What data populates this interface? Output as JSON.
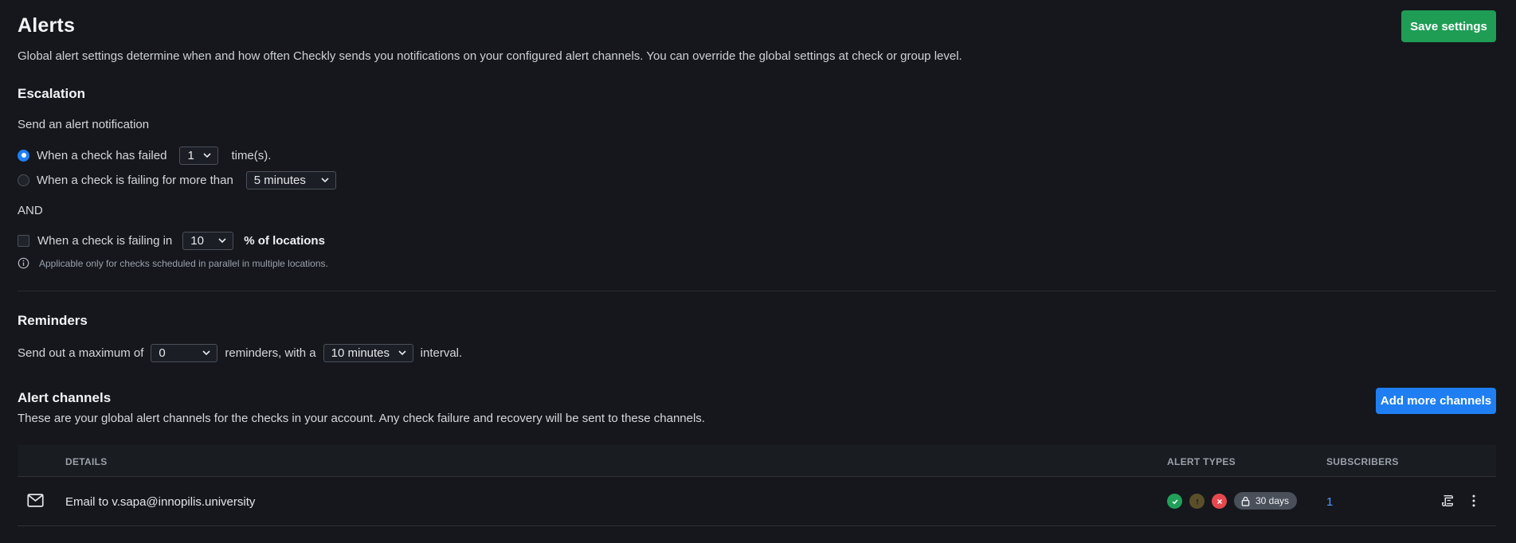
{
  "header": {
    "title": "Alerts",
    "description": "Global alert settings determine when and how often Checkly sends you notifications on your configured alert channels. You can override the global settings at check or group level.",
    "save_label": "Save settings"
  },
  "escalation": {
    "title": "Escalation",
    "intro": "Send an alert notification",
    "option_failed": {
      "label": "When a check has failed",
      "value": "1",
      "suffix": "time(s).",
      "selected": true
    },
    "option_failing_for": {
      "label": "When a check is failing for more than",
      "value": "5 minutes",
      "selected": false
    },
    "and_label": "AND",
    "locations": {
      "label": "When a check is failing in",
      "value": "10",
      "suffix": "% of locations",
      "checked": false
    },
    "note": "Applicable only for checks scheduled in parallel in multiple locations."
  },
  "reminders": {
    "title": "Reminders",
    "prefix": "Send out a maximum of",
    "count_value": "0",
    "middle": "reminders, with a",
    "interval_value": "10 minutes",
    "suffix": "interval."
  },
  "channels": {
    "title": "Alert channels",
    "description": "These are your global alert channels for the checks in your account. Any check failure and recovery will be sent to these channels.",
    "add_label": "Add more channels",
    "columns": {
      "details": "DETAILS",
      "alert_types": "ALERT TYPES",
      "subscribers": "SUBSCRIBERS"
    },
    "rows": [
      {
        "icon": "mail-icon",
        "details": "Email to v.sapa@innopilis.university",
        "retention": "30 days",
        "subscribers": "1"
      }
    ]
  },
  "colors": {
    "background": "#15171c",
    "green": "#1f9d55",
    "blue": "#1f7ff2",
    "recovered": "#22a05a",
    "degraded": "#5a4f2a",
    "failure": "#e5484d",
    "link": "#4c9cff"
  }
}
